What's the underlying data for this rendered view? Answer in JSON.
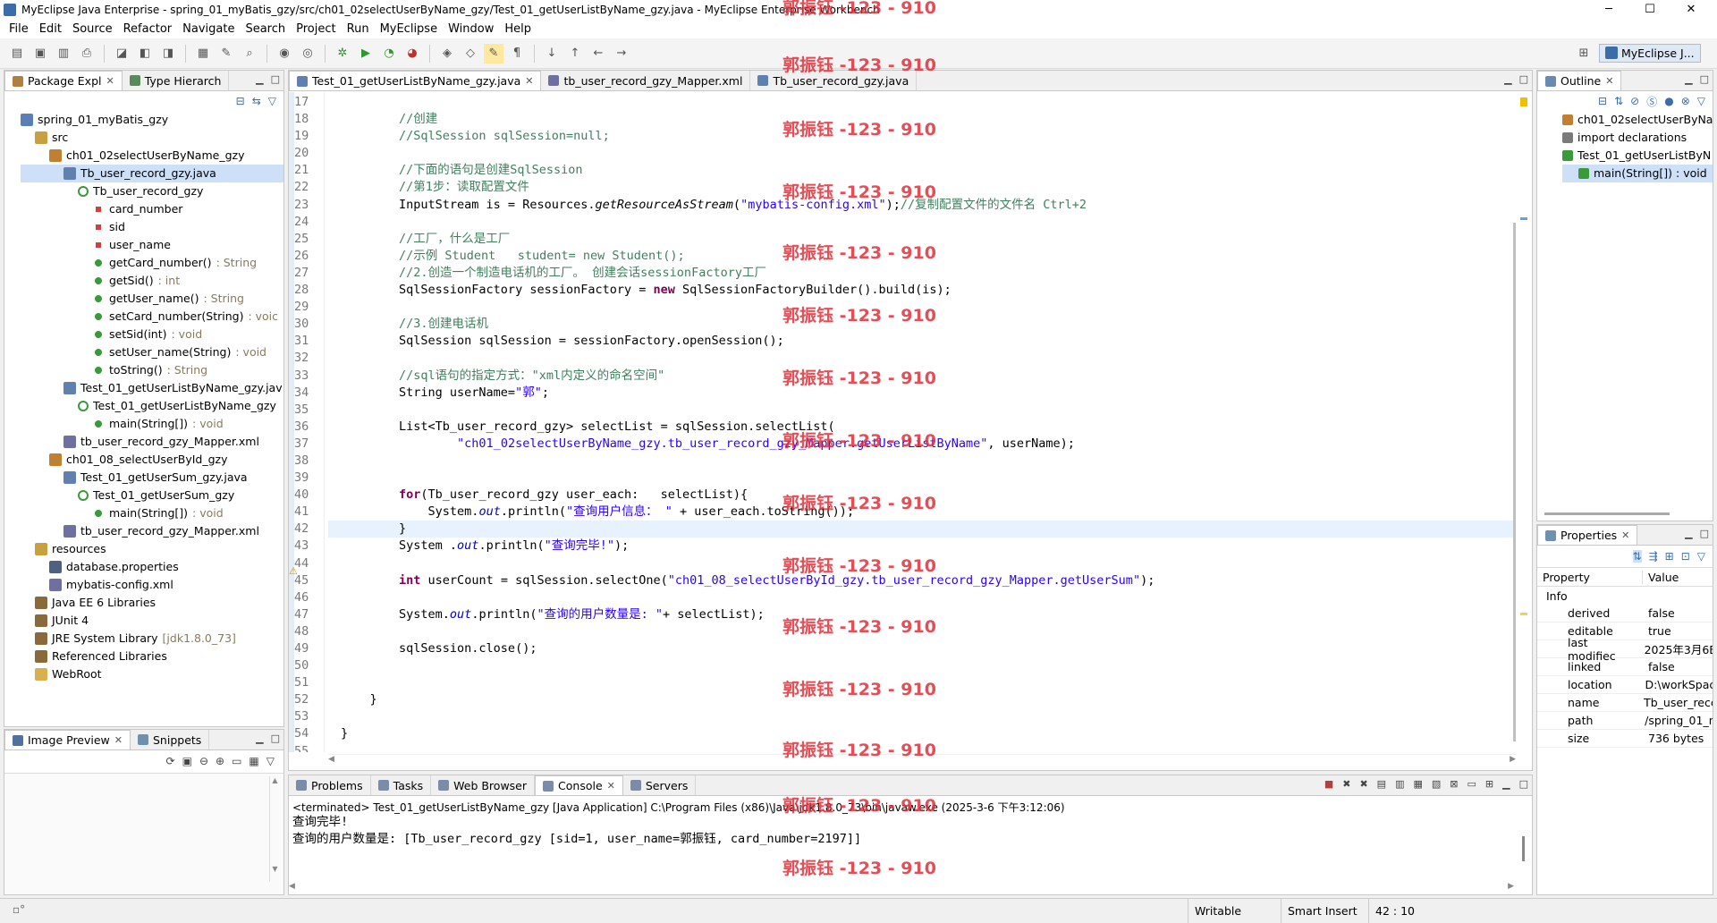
{
  "window": {
    "title": "MyEclipse Java Enterprise - spring_01_myBatis_gzy/src/ch01_02selectUserByName_gzy/Test_01_getUserListByName_gzy.java - MyEclipse Enterprise Workbench",
    "minimize": "─",
    "maximize": "☐",
    "close": "✕"
  },
  "menu": [
    "File",
    "Edit",
    "Source",
    "Refactor",
    "Navigate",
    "Search",
    "Project",
    "Run",
    "MyEclipse",
    "Window",
    "Help"
  ],
  "perspective": {
    "label": "MyEclipse J..."
  },
  "watermark": "郭振钰 -123 - 910",
  "left_panel": {
    "tabs": [
      {
        "label": "Package Expl"
      },
      {
        "label": "Type Hierarch"
      }
    ],
    "tree": [
      {
        "label": "spring_01_myBatis_gzy",
        "suffix": "",
        "indent": 0,
        "icon": "project-icon",
        "color": "#5a7fb5"
      },
      {
        "label": "src",
        "suffix": "",
        "indent": 1,
        "icon": "source-folder-icon",
        "color": "#c8a040"
      },
      {
        "label": "ch01_02selectUserByName_gzy",
        "suffix": "",
        "indent": 2,
        "icon": "package-icon",
        "color": "#c08030"
      },
      {
        "label": "Tb_user_record_gzy.java",
        "suffix": "",
        "indent": 3,
        "icon": "java-file-icon",
        "color": "#6080b0",
        "selected": true
      },
      {
        "label": "Tb_user_record_gzy",
        "suffix": "",
        "indent": 4,
        "icon": "class-icon",
        "color": "#3a9a3a"
      },
      {
        "label": "card_number",
        "suffix": "",
        "indent": 5,
        "icon": "private-field-icon",
        "color": "#d04040"
      },
      {
        "label": "sid",
        "suffix": "",
        "indent": 5,
        "icon": "private-field-icon",
        "color": "#d04040"
      },
      {
        "label": "user_name",
        "suffix": "",
        "indent": 5,
        "icon": "private-field-icon",
        "color": "#d04040"
      },
      {
        "label": "getCard_number()",
        "suffix": " : String",
        "indent": 5,
        "icon": "public-method-icon",
        "color": "#3a9a3a"
      },
      {
        "label": "getSid()",
        "suffix": " : int",
        "indent": 5,
        "icon": "public-method-icon",
        "color": "#3a9a3a"
      },
      {
        "label": "getUser_name()",
        "suffix": " : String",
        "indent": 5,
        "icon": "public-method-icon",
        "color": "#3a9a3a"
      },
      {
        "label": "setCard_number(String)",
        "suffix": " : voic",
        "indent": 5,
        "icon": "public-method-icon",
        "color": "#3a9a3a"
      },
      {
        "label": "setSid(int)",
        "suffix": " : void",
        "indent": 5,
        "icon": "public-method-icon",
        "color": "#3a9a3a"
      },
      {
        "label": "setUser_name(String)",
        "suffix": " : void",
        "indent": 5,
        "icon": "public-method-icon",
        "color": "#3a9a3a"
      },
      {
        "label": "toString()",
        "suffix": " : String",
        "indent": 5,
        "icon": "public-method-icon",
        "color": "#3a9a3a"
      },
      {
        "label": "Test_01_getUserListByName_gzy.jav",
        "suffix": "",
        "indent": 3,
        "icon": "java-file-icon",
        "color": "#6080b0"
      },
      {
        "label": "Test_01_getUserListByName_gzy",
        "suffix": "",
        "indent": 4,
        "icon": "class-icon",
        "color": "#3a9a3a"
      },
      {
        "label": "main(String[])",
        "suffix": " : void",
        "indent": 5,
        "icon": "static-method-icon",
        "color": "#3a9a3a"
      },
      {
        "label": "tb_user_record_gzy_Mapper.xml",
        "suffix": "",
        "indent": 3,
        "icon": "xml-file-icon",
        "color": "#7070a0"
      },
      {
        "label": "ch01_08_selectUserById_gzy",
        "suffix": "",
        "indent": 2,
        "icon": "package-icon",
        "color": "#c08030"
      },
      {
        "label": "Test_01_getUserSum_gzy.java",
        "suffix": "",
        "indent": 3,
        "icon": "java-file-icon",
        "color": "#6080b0"
      },
      {
        "label": "Test_01_getUserSum_gzy",
        "suffix": "",
        "indent": 4,
        "icon": "class-icon",
        "color": "#3a9a3a"
      },
      {
        "label": "main(String[])",
        "suffix": " : void",
        "indent": 5,
        "icon": "static-method-icon",
        "color": "#3a9a3a"
      },
      {
        "label": "tb_user_record_gzy_Mapper.xml",
        "suffix": "",
        "indent": 3,
        "icon": "xml-file-icon",
        "color": "#7070a0"
      },
      {
        "label": "resources",
        "suffix": "",
        "indent": 1,
        "icon": "source-folder-icon",
        "color": "#c8a040"
      },
      {
        "label": "database.properties",
        "suffix": "",
        "indent": 2,
        "icon": "properties-file-icon",
        "color": "#506080"
      },
      {
        "label": "mybatis-config.xml",
        "suffix": "",
        "indent": 2,
        "icon": "xml-file-icon",
        "color": "#7070a0"
      },
      {
        "label": "Java EE 6 Libraries",
        "suffix": "",
        "indent": 1,
        "icon": "library-icon",
        "color": "#8a6a3a"
      },
      {
        "label": "JUnit 4",
        "suffix": "",
        "indent": 1,
        "icon": "library-icon",
        "color": "#8a6a3a"
      },
      {
        "label": "JRE System Library",
        "suffix": " [jdk1.8.0_73]",
        "indent": 1,
        "icon": "library-icon",
        "color": "#8a6a3a"
      },
      {
        "label": "Referenced Libraries",
        "suffix": "",
        "indent": 1,
        "icon": "library-icon",
        "color": "#8a6a3a"
      },
      {
        "label": "WebRoot",
        "suffix": "",
        "indent": 1,
        "icon": "folder-icon",
        "color": "#d8b050"
      }
    ]
  },
  "image_preview": {
    "tabs": [
      {
        "label": "Image Preview"
      },
      {
        "label": "Snippets"
      }
    ]
  },
  "editor": {
    "tabs": [
      {
        "label": "Test_01_getUserListByName_gzy.java",
        "active": true
      },
      {
        "label": "tb_user_record_gzy_Mapper.xml",
        "active": false
      },
      {
        "label": "Tb_user_record_gzy.java",
        "active": false
      }
    ],
    "lines": [
      {
        "n": "17",
        "html": ""
      },
      {
        "n": "18",
        "html": "        <span class='cm'>//创建</span>"
      },
      {
        "n": "19",
        "html": "        <span class='cm'>//SqlSession sqlSession=null;</span>"
      },
      {
        "n": "20",
        "html": ""
      },
      {
        "n": "21",
        "html": "        <span class='cm'>//下面的语句是创建SqlSession</span>"
      },
      {
        "n": "22",
        "html": "        <span class='cm'>//第1步：读取配置文件</span>"
      },
      {
        "n": "23",
        "html": "        InputStream is = Resources.<span class='mth'>getResourceAsStream</span>(<span class='st'>\"mybatis-config.xml\"</span>);<span class='cm'>//复制配置文件的文件名 Ctrl+2</span>"
      },
      {
        "n": "24",
        "html": ""
      },
      {
        "n": "25",
        "html": "        <span class='cm'>//工厂，什么是工厂</span>"
      },
      {
        "n": "26",
        "html": "        <span class='cm'>//示例 Student   student= new Student();</span>"
      },
      {
        "n": "27",
        "html": "        <span class='cm'>//2.创造一个制造电话机的工厂。 创建会话sessionFactory工厂</span>"
      },
      {
        "n": "28",
        "html": "        SqlSessionFactory sessionFactory = <span class='kw'>new</span> SqlSessionFactoryBuilder().build(is);"
      },
      {
        "n": "29",
        "html": ""
      },
      {
        "n": "30",
        "html": "        <span class='cm'>//3.创建电话机</span>"
      },
      {
        "n": "31",
        "html": "        SqlSession sqlSession = sessionFactory.openSession();"
      },
      {
        "n": "32",
        "html": ""
      },
      {
        "n": "33",
        "html": "        <span class='cm'>//sql语句的指定方式：\"xml内定义的命名空间\"</span>"
      },
      {
        "n": "34",
        "html": "        String userName=<span class='st'>\"郭\"</span>;"
      },
      {
        "n": "35",
        "html": ""
      },
      {
        "n": "36",
        "html": "        List&lt;Tb_user_record_gzy&gt; selectList = sqlSession.selectList("
      },
      {
        "n": "37",
        "html": "                <span class='st'>\"ch01_02selectUserByName_gzy.tb_user_record_gzy_Mapper.getUserListByName\"</span>, userName);"
      },
      {
        "n": "38",
        "html": ""
      },
      {
        "n": "39",
        "html": ""
      },
      {
        "n": "40",
        "html": "        <span class='kw'>for</span>(Tb_user_record_gzy user_each:   selectList){"
      },
      {
        "n": "41",
        "html": "            System.<span class='it'>out</span>.println(<span class='st'>\"查询用户信息： \"</span> + user_each.toString());"
      },
      {
        "n": "42",
        "html": "        }"
      },
      {
        "n": "43",
        "html": "        System .<span class='it'>out</span>.println(<span class='st'>\"查询完毕!\"</span>);"
      },
      {
        "n": "44",
        "html": ""
      },
      {
        "n": "45",
        "html": "        <span class='kw'>int</span> userCount = sqlSession.selectOne(<span class='st'>\"ch01_08_selectUserById_gzy.tb_user_record_gzy_Mapper.getUserSum\"</span>);"
      },
      {
        "n": "46",
        "html": ""
      },
      {
        "n": "47",
        "html": "        System.<span class='it'>out</span>.println(<span class='st'>\"查询的用户数量是: \"</span>+ selectList);"
      },
      {
        "n": "48",
        "html": ""
      },
      {
        "n": "49",
        "html": "        sqlSession.close();"
      },
      {
        "n": "50",
        "html": ""
      },
      {
        "n": "51",
        "html": ""
      },
      {
        "n": "52",
        "html": "    }"
      },
      {
        "n": "53",
        "html": ""
      },
      {
        "n": "54",
        "html": "}"
      },
      {
        "n": "55",
        "html": ""
      }
    ]
  },
  "outline": {
    "tab": "Outline",
    "items": [
      {
        "label": "ch01_02selectUserByNa",
        "icon": "package-icon",
        "indent": 0
      },
      {
        "label": "import declarations",
        "icon": "imports-icon",
        "indent": 0
      },
      {
        "label": "Test_01_getUserListByN",
        "icon": "class-icon",
        "indent": 0
      },
      {
        "label": "main(String[]) : void",
        "icon": "static-method-icon",
        "indent": 1,
        "selected": true
      }
    ]
  },
  "properties": {
    "tab": "Properties",
    "col_property": "Property",
    "col_value": "Value",
    "group": "Info",
    "rows": [
      {
        "k": "derived",
        "v": "false"
      },
      {
        "k": "editable",
        "v": "true"
      },
      {
        "k": "last modifiec",
        "v": "2025年3月6E"
      },
      {
        "k": "linked",
        "v": "false"
      },
      {
        "k": "location",
        "v": "D:\\workSpac"
      },
      {
        "k": "name",
        "v": "Tb_user_recc"
      },
      {
        "k": "path",
        "v": "/spring_01_n"
      },
      {
        "k": "size",
        "v": "736  bytes"
      }
    ]
  },
  "console": {
    "tabs": [
      {
        "label": "Problems"
      },
      {
        "label": "Tasks"
      },
      {
        "label": "Web Browser"
      },
      {
        "label": "Console",
        "active": true
      },
      {
        "label": "Servers"
      }
    ],
    "header": "<terminated> Test_01_getUserListByName_gzy [Java Application] C:\\Program Files (x86)\\Java\\jdk1.8.0_73\\bin\\javaw.exe (2025-3-6 下午3:12:06)",
    "lines": [
      "查询完毕!",
      "查询的用户数量是: [Tb_user_record_gzy [sid=1, user_name=郭振钰, card_number=2197]]"
    ]
  },
  "status": {
    "writable": "Writable",
    "insert_mode": "Smart Insert",
    "position": "42 : 10"
  }
}
